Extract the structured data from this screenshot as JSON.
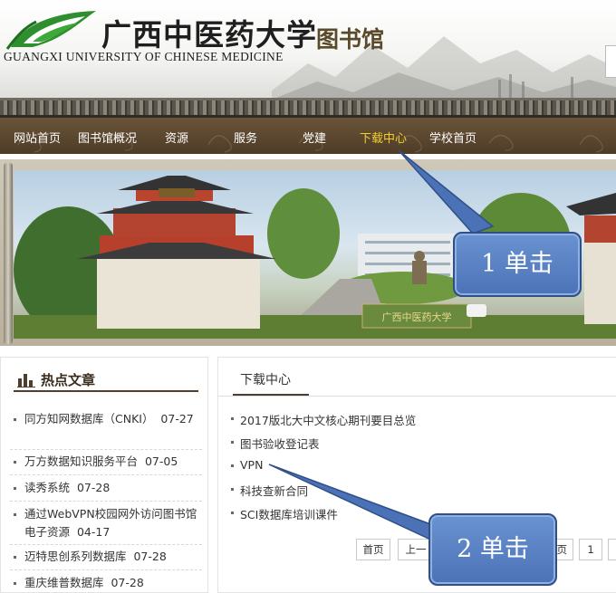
{
  "header": {
    "school_name_cn": "广西中医药大学",
    "library_name": "图书馆",
    "school_name_en": "GUANGXI UNIVERSITY OF CHINESE MEDICINE"
  },
  "nav": {
    "items": [
      "网站首页",
      "图书馆概况",
      "资源",
      "服务",
      "党建",
      "下载中心",
      "学校首页"
    ],
    "active_index": 5
  },
  "banner": {
    "plaque_text": "广西中医药大学"
  },
  "hot_articles": {
    "title": "热点文章",
    "items": [
      {
        "title": "同方知网数据库（CNKI）",
        "date": "07-27"
      },
      {
        "title": "万方数据知识服务平台",
        "date": "07-05"
      },
      {
        "title": "读秀系统",
        "date": "07-28"
      },
      {
        "title": "通过WebVPN校园网外访问图书馆电子资源",
        "date": "04-17"
      },
      {
        "title": "迈特思创系列数据库",
        "date": "07-28"
      },
      {
        "title": "重庆维普数据库",
        "date": "07-28"
      }
    ]
  },
  "downloads": {
    "tab": "下载中心",
    "items": [
      "2017版北大中文核心期刊要目总览",
      "图书验收登记表",
      "VPN",
      "科技查新合同",
      "SCI数据库培训课件"
    ]
  },
  "pagination": {
    "first": "首页",
    "prev": "上一",
    "last_partial": "页",
    "current": "1"
  },
  "annotations": {
    "step1": "1 单击",
    "step2": "2 单击"
  },
  "colors": {
    "nav_bg": "#5a4630",
    "nav_active": "#f5cf2d",
    "callout": "#5b82c4",
    "accent_brown": "#4f3e2c"
  }
}
